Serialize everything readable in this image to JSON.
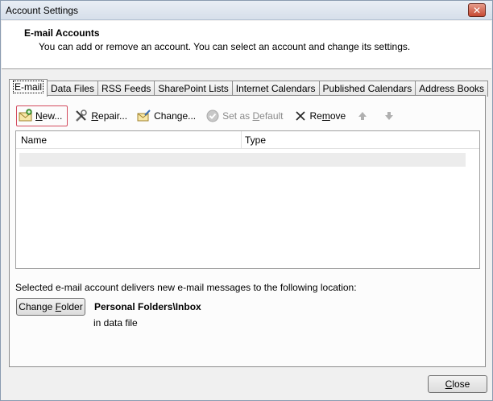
{
  "window": {
    "title": "Account Settings",
    "close_glyph": "✕"
  },
  "header": {
    "title": "E-mail Accounts",
    "description": "You can add or remove an account. You can select an account and change its settings."
  },
  "tabs": [
    {
      "label": "E-mail",
      "active": true
    },
    {
      "label": "Data Files"
    },
    {
      "label": "RSS Feeds"
    },
    {
      "label": "SharePoint Lists"
    },
    {
      "label": "Internet Calendars"
    },
    {
      "label": "Published Calendars"
    },
    {
      "label": "Address Books"
    }
  ],
  "toolbar": {
    "new_key": "N",
    "new_rest": "ew...",
    "repair_key": "R",
    "repair_rest": "epair...",
    "change_pre": "Chan",
    "change_key": "g",
    "change_rest": "e...",
    "setdefault_pre": "Set as ",
    "setdefault_key": "D",
    "setdefault_rest": "efault",
    "remove_pre": "Re",
    "remove_key": "m",
    "remove_rest": "ove",
    "up_icon": "up-arrow-icon",
    "down_icon": "down-arrow-icon"
  },
  "list": {
    "col_name": "Name",
    "col_type": "Type"
  },
  "delivery": {
    "text": "Selected e-mail account delivers new e-mail messages to the following location:",
    "change_folder_pre": "Change ",
    "change_folder_key": "F",
    "change_folder_rest": "older",
    "folder_path": "Personal Folders\\Inbox",
    "data_file": "in data file"
  },
  "footer": {
    "close_key": "C",
    "close_rest": "lose"
  },
  "colors": {
    "highlight_border": "#d34b5e",
    "disabled_text": "#8a8a8a"
  }
}
